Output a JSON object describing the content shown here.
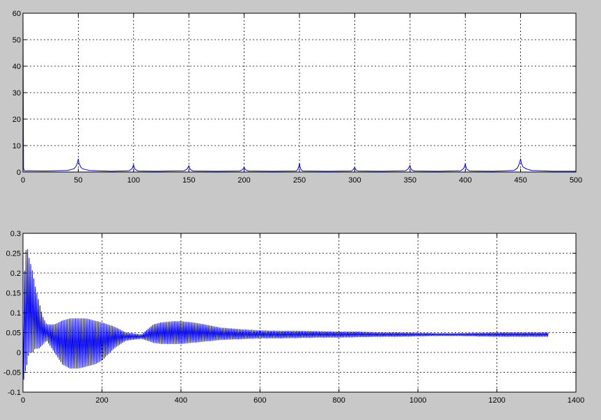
{
  "colors": {
    "figure_background": "#c8c8c8",
    "axes_background": "#ffffff",
    "line": "#0000ee",
    "grid": "#000000"
  },
  "chart_data": [
    {
      "type": "line",
      "title": "",
      "xlabel": "",
      "ylabel": "",
      "xlim": [
        0,
        500
      ],
      "ylim": [
        0,
        60
      ],
      "xticks": [
        0,
        50,
        100,
        150,
        200,
        250,
        300,
        350,
        400,
        450,
        500
      ],
      "yticks": [
        0,
        10,
        20,
        30,
        40,
        50,
        60
      ],
      "grid": true,
      "series": [
        {
          "x": [
            0,
            0.5,
            1,
            2,
            5,
            20,
            40,
            46,
            48,
            49.5,
            50,
            50.5,
            52,
            54,
            60,
            80,
            96,
            98.5,
            99.5,
            100,
            100.5,
            101.5,
            104,
            120,
            146,
            148.5,
            149.5,
            150,
            150.5,
            151.5,
            154,
            175,
            196,
            198.5,
            199.5,
            200,
            200.5,
            201.5,
            204,
            225,
            247,
            248.5,
            249.5,
            250,
            250.5,
            251.5,
            253,
            275,
            297,
            298.5,
            299.5,
            300,
            300.5,
            301.5,
            303,
            325,
            346,
            348.5,
            349.5,
            350,
            350.5,
            351.5,
            354,
            375,
            396,
            398.5,
            399.5,
            400,
            400.5,
            401.5,
            404,
            425,
            444,
            447,
            448.5,
            449.5,
            450,
            450.5,
            452,
            455,
            460,
            480,
            500
          ],
          "y": [
            60,
            1.5,
            0.6,
            0.4,
            0.5,
            0.4,
            0.6,
            1.2,
            2.2,
            3.8,
            5,
            3.6,
            2.0,
            1.2,
            0.6,
            0.3,
            0.5,
            1.2,
            2.2,
            2.8,
            1.8,
            1.0,
            0.4,
            0.3,
            0.5,
            1.2,
            2.0,
            2.4,
            1.6,
            0.9,
            0.4,
            0.3,
            0.4,
            0.9,
            1.5,
            2.0,
            1.3,
            0.8,
            0.4,
            0.3,
            0.4,
            1.0,
            2.2,
            3.4,
            2.0,
            0.9,
            0.4,
            0.3,
            0.4,
            0.9,
            1.5,
            1.9,
            1.2,
            0.7,
            0.4,
            0.3,
            0.5,
            1.3,
            2.2,
            2.5,
            1.6,
            0.8,
            0.4,
            0.3,
            0.5,
            1.4,
            2.4,
            3.2,
            2.0,
            1.0,
            0.4,
            0.3,
            0.6,
            1.5,
            2.8,
            4.2,
            5,
            3.6,
            2.0,
            1.2,
            0.6,
            0.3,
            0.3
          ]
        }
      ]
    },
    {
      "type": "line",
      "title": "",
      "xlabel": "",
      "ylabel": "",
      "xlim": [
        0,
        1400
      ],
      "ylim": [
        -0.1,
        0.3
      ],
      "xticks": [
        0,
        200,
        400,
        600,
        800,
        1000,
        1200,
        1400
      ],
      "yticks": [
        -0.1,
        -0.05,
        0,
        0.05,
        0.1,
        0.15,
        0.2,
        0.25,
        0.3
      ],
      "yticklabels": [
        "-0.1",
        "-0.05",
        "0",
        "0.05",
        "0.1",
        "0.15",
        "0.2",
        "0.25",
        "0.3"
      ],
      "grid": true,
      "series": [
        {
          "x_range": [
            0,
            1330
          ],
          "envelope": {
            "x": [
              0,
              5,
              10,
              15,
              20,
              25,
              30,
              40,
              50,
              60,
              80,
              100,
              120,
              140,
              160,
              180,
              200,
              230,
              260,
              300,
              330,
              350,
              380,
              400,
              430,
              460,
              500,
              550,
              600,
              650,
              700,
              750,
              800,
              850,
              900,
              950,
              1000,
              1050,
              1100,
              1150,
              1200,
              1250,
              1300,
              1330
            ],
            "upper": [
              0.08,
              0.24,
              0.27,
              0.24,
              0.22,
              0.2,
              0.17,
              0.13,
              0.09,
              0.07,
              0.07,
              0.08,
              0.085,
              0.085,
              0.085,
              0.08,
              0.075,
              0.065,
              0.05,
              0.045,
              0.07,
              0.075,
              0.078,
              0.078,
              0.075,
              0.07,
              0.062,
              0.058,
              0.055,
              0.054,
              0.054,
              0.053,
              0.052,
              0.052,
              0.05,
              0.05,
              0.049,
              0.048,
              0.048,
              0.049,
              0.05,
              0.05,
              0.05,
              0.05
            ],
            "lower": [
              -0.08,
              -0.05,
              -0.03,
              0.0,
              0.0,
              0.0,
              0.01,
              0.01,
              0.02,
              0.03,
              0.0,
              -0.03,
              -0.04,
              -0.04,
              -0.035,
              -0.03,
              -0.02,
              0.01,
              0.03,
              0.035,
              0.025,
              0.022,
              0.022,
              0.022,
              0.025,
              0.028,
              0.032,
              0.034,
              0.036,
              0.036,
              0.037,
              0.038,
              0.038,
              0.039,
              0.04,
              0.04,
              0.041,
              0.042,
              0.042,
              0.041,
              0.04,
              0.04,
              0.04,
              0.04
            ]
          }
        }
      ]
    }
  ]
}
